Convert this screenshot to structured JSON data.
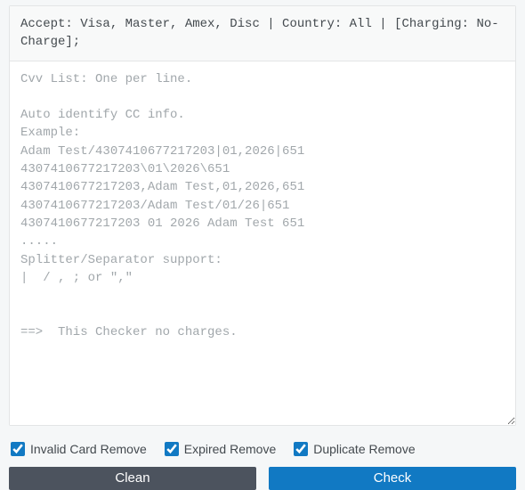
{
  "header": {
    "text": "Accept: Visa, Master, Amex, Disc | Country: All | [Charging: No-Charge];"
  },
  "textarea": {
    "value": "",
    "placeholder": "Cvv List: One per line.\n\nAuto identify CC info.\nExample:\nAdam Test/4307410677217203|01,2026|651\n4307410677217203\\01\\2026\\651\n4307410677217203,Adam Test,01,2026,651\n4307410677217203/Adam Test/01/26|651\n4307410677217203 01 2026 Adam Test 651\n.....\nSplitter/Separator support:\n|  / , ; or \",\"\n\n\n==>  This Checker no charges."
  },
  "checkboxes": {
    "invalid": {
      "label": "Invalid Card Remove",
      "checked": true
    },
    "expired": {
      "label": "Expired Remove",
      "checked": true
    },
    "duplicate": {
      "label": "Duplicate Remove",
      "checked": true
    }
  },
  "buttons": {
    "clean": "Clean",
    "check": "Check"
  }
}
